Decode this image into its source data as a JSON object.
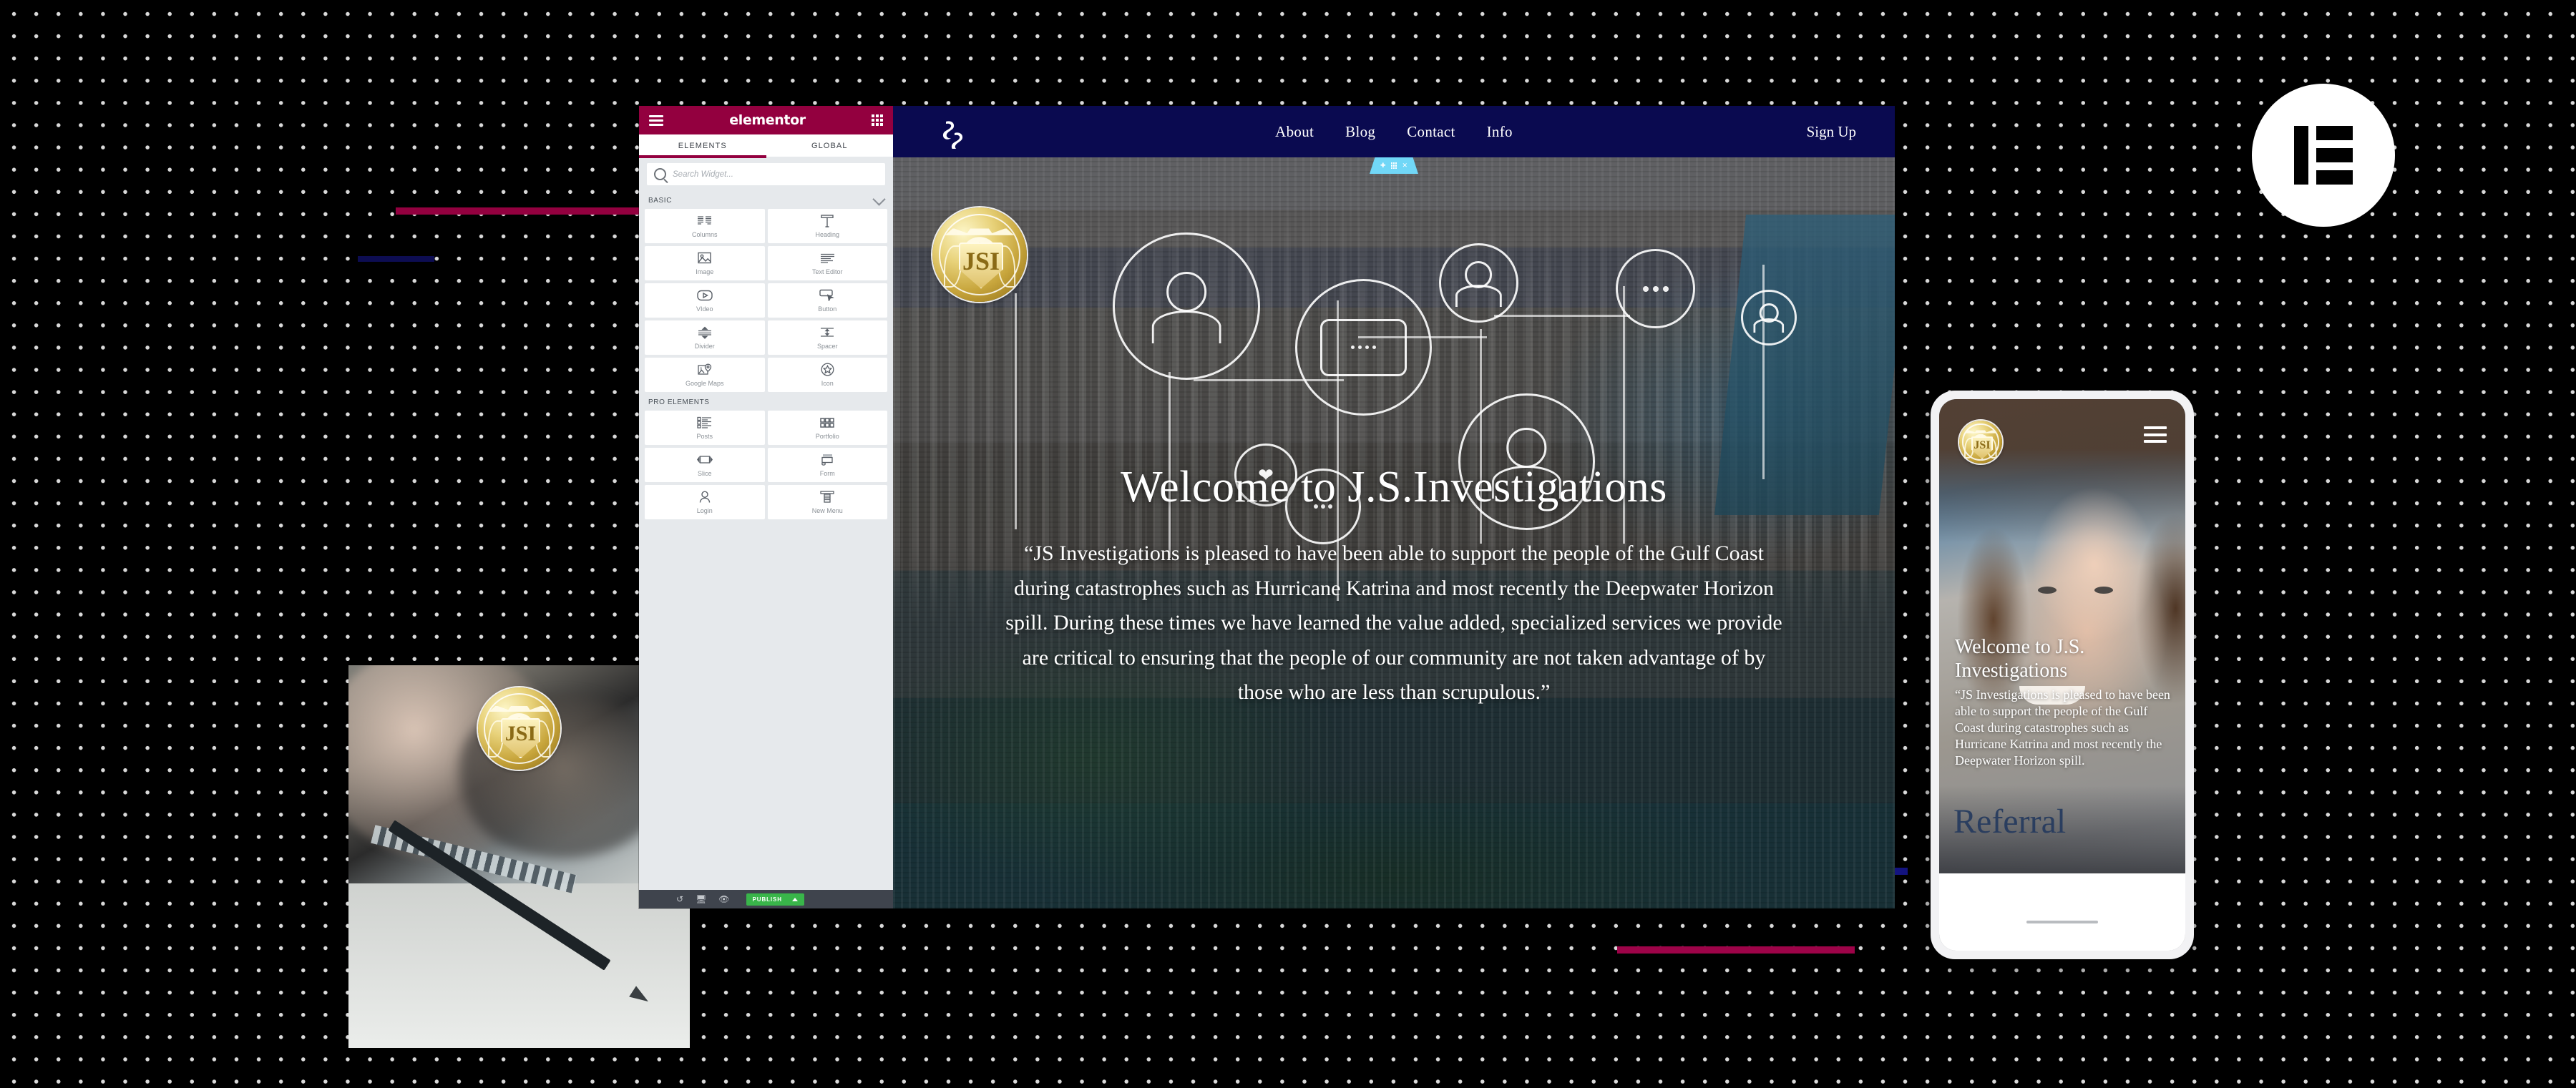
{
  "editor": {
    "brand": "elementor",
    "menu_icon": "hamburger-icon",
    "apps_icon": "grid-apps-icon",
    "tabs": [
      {
        "label": "ELEMENTS",
        "active": true
      },
      {
        "label": "GLOBAL",
        "active": false
      }
    ],
    "search": {
      "placeholder": "Search Widget...",
      "value": "",
      "icon": "search-icon"
    },
    "categories": [
      {
        "title": "BASIC",
        "widgets": [
          {
            "label": "Columns",
            "icon": "columns-icon"
          },
          {
            "label": "Heading",
            "icon": "heading-icon"
          },
          {
            "label": "Image",
            "icon": "image-icon"
          },
          {
            "label": "Text Editor",
            "icon": "text-editor-icon"
          },
          {
            "label": "VIdeo",
            "icon": "video-icon"
          },
          {
            "label": "Button",
            "icon": "button-icon"
          },
          {
            "label": "Divider",
            "icon": "divider-icon"
          },
          {
            "label": "Spacer",
            "icon": "spacer-icon"
          },
          {
            "label": "Google Maps",
            "icon": "google-maps-icon"
          },
          {
            "label": "Icon",
            "icon": "star-icon"
          }
        ]
      },
      {
        "title": "PRO ELEMENTS",
        "widgets": [
          {
            "label": "Posts",
            "icon": "posts-icon"
          },
          {
            "label": "Portfolio",
            "icon": "portfolio-icon"
          },
          {
            "label": "Slice",
            "icon": "slice-icon"
          },
          {
            "label": "Form",
            "icon": "form-icon"
          },
          {
            "label": "Login",
            "icon": "login-user-icon"
          },
          {
            "label": "New Menu",
            "icon": "new-menu-icon"
          }
        ]
      }
    ],
    "footer": {
      "history_icon": "history-revert-icon",
      "responsive_icon": "desktop-monitor-icon",
      "preview_icon": "eye-preview-icon",
      "publish_label": "PUBLISH",
      "publish_caret": "caret-up-icon",
      "publish_color": "#39b54a"
    },
    "accent_color": "#93003f"
  },
  "site": {
    "nav": {
      "logo_icon": "jsi-monogram-icon",
      "links": [
        "About",
        "Blog",
        "Contact",
        "Info"
      ],
      "cta": "Sign Up",
      "bg_color": "#0a0a50"
    },
    "section_handle": {
      "add_icon": "plus-icon",
      "drag_icon": "drag-dots-icon",
      "close_icon": "close-x-icon",
      "color": "#71d7f7"
    },
    "hero": {
      "badge_icon": "jsi-coin-logo",
      "heading": "Welcome to J.S.Investigations",
      "paragraph": "“JS Investigations is pleased to have been able to support the people of the Gulf Coast during catastrophes such as Hurricane Katrina and most recently the Deepwater Horizon spill. During these times we have learned the value added, specialized services we provide are critical to ensuring that the people of our community are not taken advantage of by those who are less than scrupulous.”",
      "overlay_nodes": [
        "person-node",
        "chat-bubble-node",
        "group-people-node",
        "dots-node",
        "heart-node",
        "avatar-node"
      ]
    }
  },
  "phone": {
    "logo_icon": "jsi-coin-logo",
    "menu_icon": "hamburger-icon",
    "heading": "Welcome to J.S. Investigations",
    "paragraph": "“JS Investigations is pleased to have been able to support the people of the Gulf Coast during catastrophes such as Hurricane Katrina and most recently the Deepwater Horizon spill.",
    "referral_label": "Referral",
    "home_indicator": "home-indicator"
  },
  "decor": {
    "elementor_badge_icon": "elementor-logo-icon",
    "notepad_logo_icon": "jsi-coin-logo",
    "bar_crimson": "#93003f",
    "bar_navy": "#0d0d52",
    "background_color": "#000000",
    "dot_color": "#d9d9d9"
  }
}
